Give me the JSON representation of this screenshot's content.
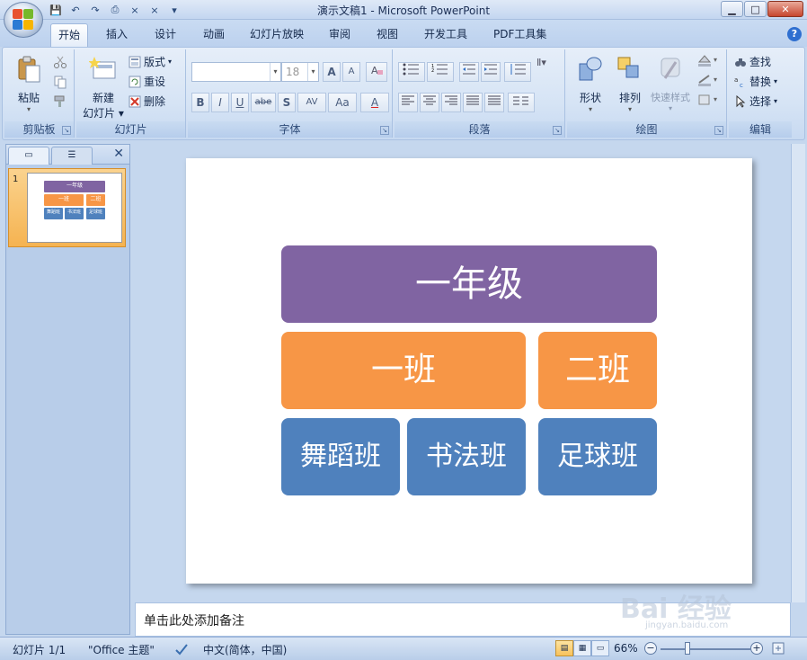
{
  "window": {
    "title": "演示文稿1 - Microsoft PowerPoint",
    "minimize": "▁",
    "maximize": "□",
    "close": "✕"
  },
  "qat": {
    "save": "💾",
    "undo": "↶",
    "redo": "↷",
    "print": "⎙",
    "x1": "×",
    "x2": "×",
    "more": "▾"
  },
  "tabs": [
    "开始",
    "插入",
    "设计",
    "动画",
    "幻灯片放映",
    "审阅",
    "视图",
    "开发工具",
    "PDF工具集"
  ],
  "active_tab": "开始",
  "help": "?",
  "ribbon": {
    "clipboard": {
      "label": "剪贴板",
      "paste": "粘贴"
    },
    "slides": {
      "label": "幻灯片",
      "new_slide_line1": "新建",
      "new_slide_line2": "幻灯片",
      "layout": "版式",
      "reset": "重设",
      "delete": "删除"
    },
    "font": {
      "label": "字体",
      "font_name": "",
      "font_size": "18",
      "grow": "A",
      "shrink": "A",
      "bold": "B",
      "italic": "I",
      "underline": "U",
      "strike": "abe",
      "shadow": "S",
      "spacing": "AV",
      "case": "Aa",
      "color": "A"
    },
    "paragraph": {
      "label": "段落"
    },
    "drawing": {
      "label": "绘图",
      "shapes": "形状",
      "arrange": "排列",
      "quick_styles": "快速样式"
    },
    "editing": {
      "label": "编辑",
      "find": "查找",
      "replace": "替换",
      "select": "选择"
    }
  },
  "left_panel": {
    "close": "✕",
    "slide_number": "1",
    "thumbnail": {
      "title": "一年级",
      "class1": "一班",
      "class2": "二班",
      "club1": "舞蹈班",
      "club2": "书法班",
      "club3": "足球班"
    }
  },
  "slide": {
    "title_box": "一年级",
    "class1": "一班",
    "class2": "二班",
    "club1": "舞蹈班",
    "club2": "书法班",
    "club3": "足球班",
    "colors": {
      "purple": "#8064a2",
      "orange": "#f79646",
      "blue": "#4f81bd"
    }
  },
  "notes": {
    "placeholder": "单击此处添加备注"
  },
  "status": {
    "slide_info": "幻灯片 1/1",
    "theme": "\"Office 主题\"",
    "language": "中文(简体，中国)",
    "zoom": "66%",
    "zoom_out": "−",
    "zoom_in": "+"
  },
  "watermark": {
    "text": "Bai 经验",
    "sub": "jingyan.baidu.com"
  }
}
